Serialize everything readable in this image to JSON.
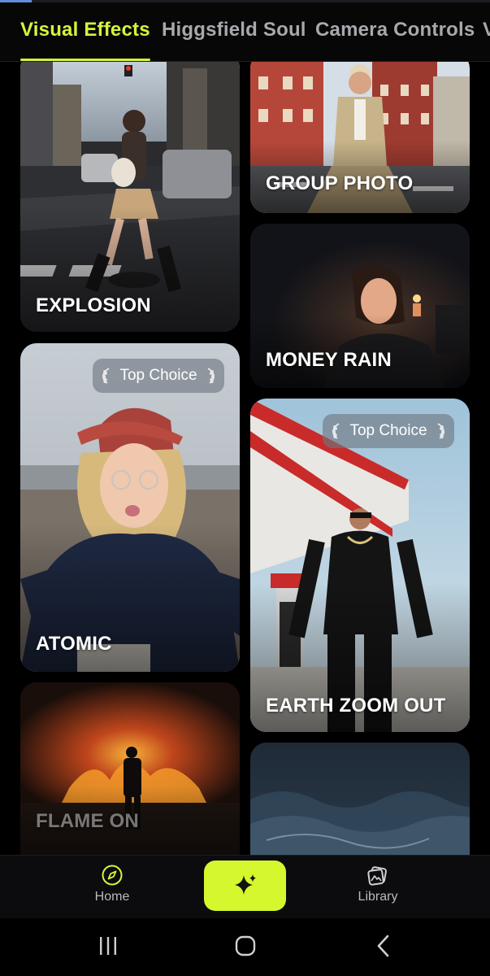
{
  "loading": {
    "progress_fraction": 0.065
  },
  "tabs": [
    {
      "label": "Visual Effects",
      "active": true
    },
    {
      "label": "Higgsfield Soul",
      "active": false
    },
    {
      "label": "Camera Controls",
      "active": false
    },
    {
      "label": "V",
      "active": false
    }
  ],
  "cards": {
    "explosion": {
      "label": "EXPLOSION"
    },
    "group_photo": {
      "label": "GROUP PHOTO"
    },
    "money_rain": {
      "label": "MONEY RAIN"
    },
    "atomic": {
      "label": "ATOMIC",
      "badge": "Top Choice"
    },
    "earth_zoom_out": {
      "label": "EARTH ZOOM OUT",
      "badge": "Top Choice"
    },
    "flame_on": {
      "label": "FLAME ON"
    },
    "ocean": {
      "label": ""
    }
  },
  "bottom_nav": {
    "home": {
      "label": "Home",
      "icon": "compass-icon"
    },
    "create": {
      "icon": "sparkle-icon"
    },
    "library": {
      "label": "Library",
      "icon": "gallery-icon"
    }
  },
  "system_nav": {
    "recents": "recents-icon",
    "home": "home-icon",
    "back": "back-icon"
  },
  "colors": {
    "accent": "#d3f53b",
    "background": "#000000",
    "tab_inactive": "#a8a8ad",
    "badge_bg": "#6e7680"
  }
}
